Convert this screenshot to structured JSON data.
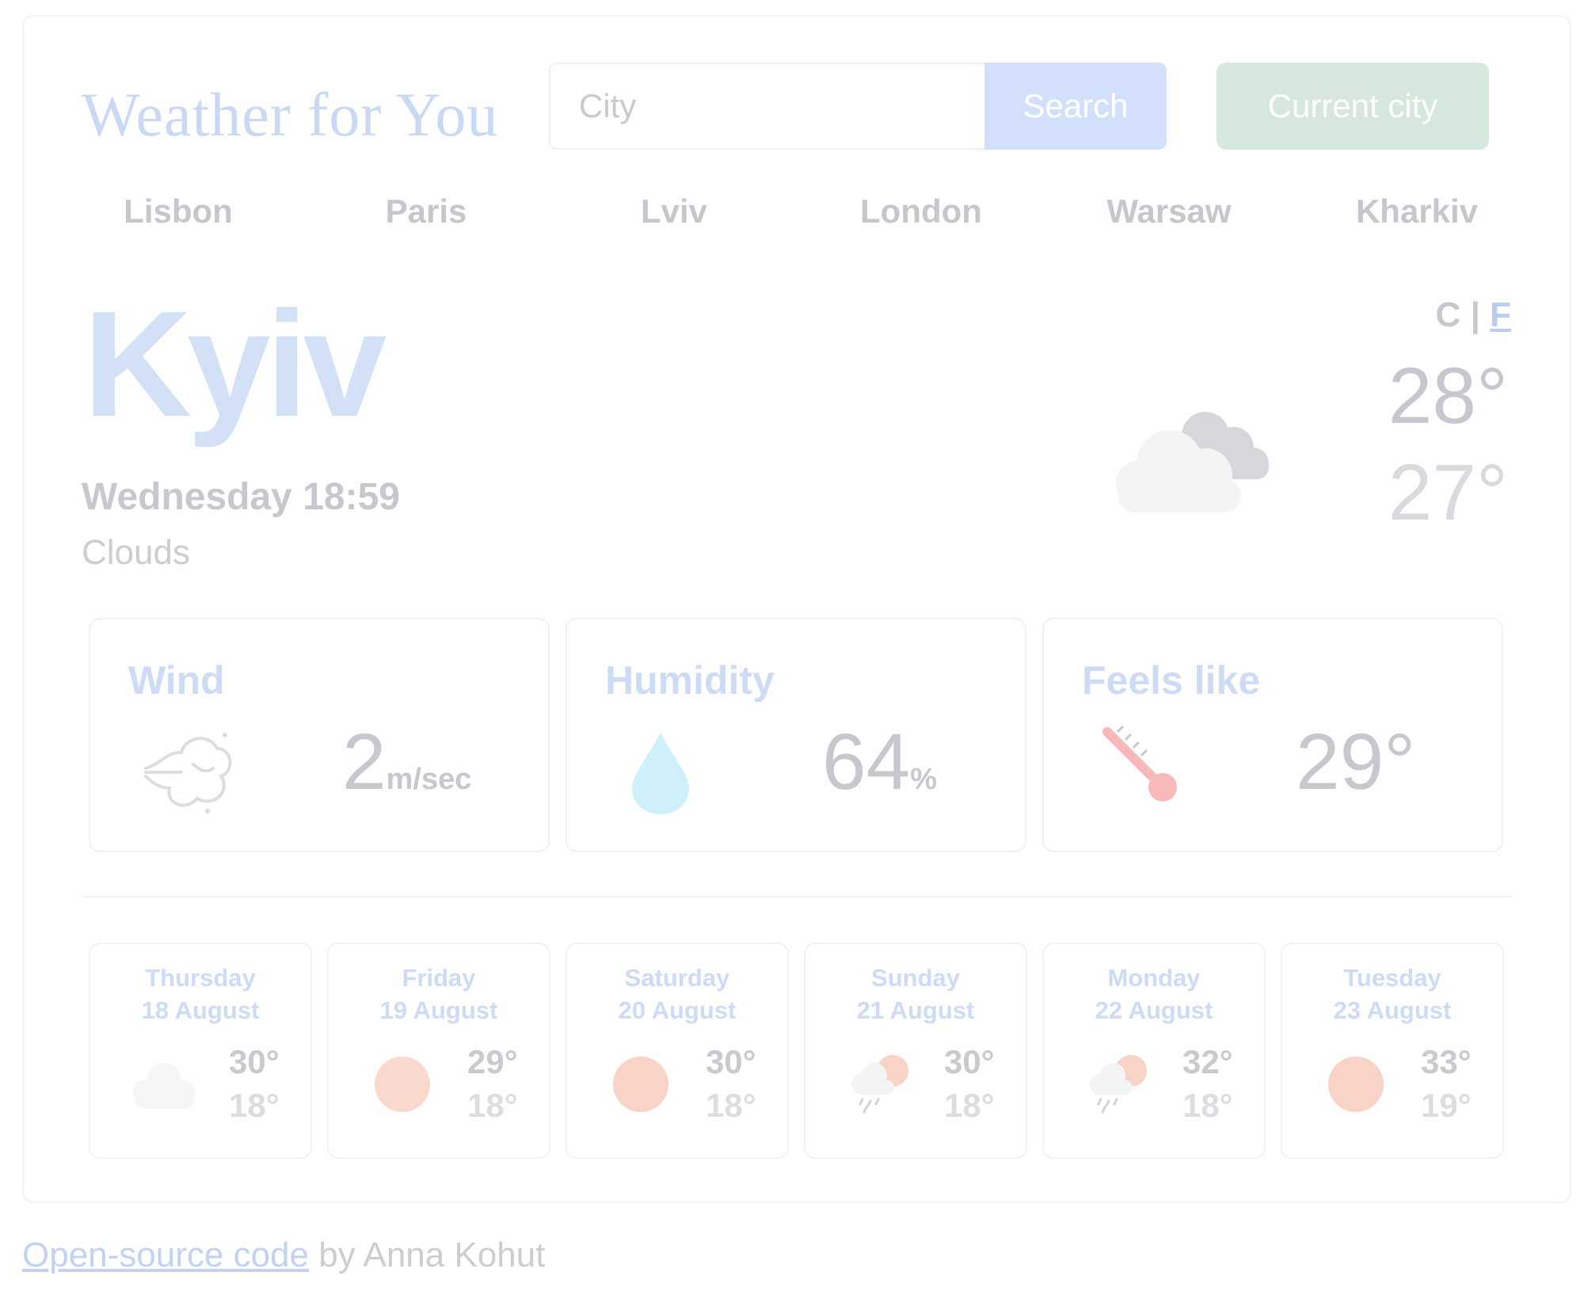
{
  "app": {
    "title": "Weather for You"
  },
  "search": {
    "placeholder": "City",
    "button_label": "Search"
  },
  "current_city_button": "Current city",
  "cities": [
    "Lisbon",
    "Paris",
    "Lviv",
    "London",
    "Warsaw",
    "Kharkiv"
  ],
  "current": {
    "city": "Kyiv",
    "datetime": "Wednesday 18:59",
    "description": "Clouds",
    "unit_c": "C",
    "unit_separator": "|",
    "unit_f": "F",
    "temp_max": "28°",
    "temp_min": "27°",
    "icon": "clouds-icon"
  },
  "stats": {
    "wind": {
      "title": "Wind",
      "value": "2",
      "unit": "m/sec",
      "icon": "wind-icon"
    },
    "humidity": {
      "title": "Humidity",
      "value": "64",
      "unit": "%",
      "icon": "droplet-icon"
    },
    "feels_like": {
      "title": "Feels like",
      "value": "29°",
      "icon": "thermometer-icon"
    }
  },
  "forecast": [
    {
      "day": "Thursday",
      "date": "18 August",
      "max": "30°",
      "min": "18°",
      "icon": "cloud-icon"
    },
    {
      "day": "Friday",
      "date": "19 August",
      "max": "29°",
      "min": "18°",
      "icon": "sun-icon"
    },
    {
      "day": "Saturday",
      "date": "20 August",
      "max": "30°",
      "min": "18°",
      "icon": "sun-icon"
    },
    {
      "day": "Sunday",
      "date": "21 August",
      "max": "30°",
      "min": "18°",
      "icon": "rain-sun-icon"
    },
    {
      "day": "Monday",
      "date": "22 August",
      "max": "32°",
      "min": "18°",
      "icon": "rain-sun-icon"
    },
    {
      "day": "Tuesday",
      "date": "23 August",
      "max": "33°",
      "min": "19°",
      "icon": "sun-icon"
    }
  ],
  "footer": {
    "link_text": "Open-source code",
    "suffix": " by Anna Kohut"
  },
  "colors": {
    "brand": "#c9d9f3",
    "search_button": "#d3e0fb",
    "current_button": "#d6e8dc",
    "sun": "#f9d3c8",
    "droplet": "#cdf0fb",
    "thermometer": "#f8b9b9"
  }
}
